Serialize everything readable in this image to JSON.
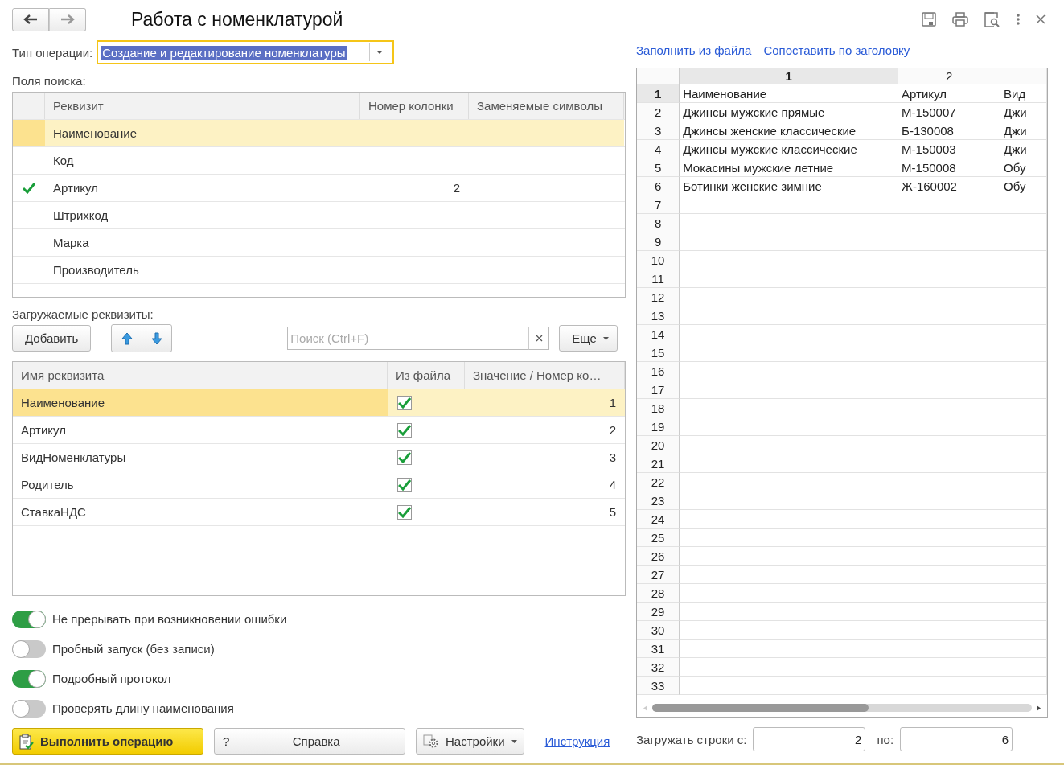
{
  "window": {
    "title": "Работа с номенклатурой"
  },
  "operation_type": {
    "label": "Тип операции:",
    "value": "Создание и редактирование номенклатуры"
  },
  "search_fields": {
    "label": "Поля поиска:",
    "columns": [
      "Реквизит",
      "Номер колонки",
      "Заменяемые символы"
    ],
    "rows": [
      {
        "name": "Наименование",
        "checked": false,
        "selected": true
      },
      {
        "name": "Код",
        "checked": false,
        "selected": false
      },
      {
        "name": "Артикул",
        "checked": true,
        "column": "2",
        "selected": false
      },
      {
        "name": "Штрихкод",
        "checked": false,
        "selected": false
      },
      {
        "name": "Марка",
        "checked": false,
        "selected": false
      },
      {
        "name": "Производитель",
        "checked": false,
        "selected": false
      }
    ]
  },
  "loaded_attributes": {
    "label": "Загружаемые реквизиты:",
    "add_button": "Добавить",
    "search": {
      "placeholder": "Поиск (Ctrl+F)"
    },
    "more_button": "Еще",
    "columns": [
      "Имя реквизита",
      "Из файла",
      "Значение / Номер ко…"
    ],
    "rows": [
      {
        "name": "Наименование",
        "from_file": true,
        "value": "1",
        "selected": true
      },
      {
        "name": "Артикул",
        "from_file": true,
        "value": "2",
        "selected": false
      },
      {
        "name": "ВидНоменклатуры",
        "from_file": true,
        "value": "3",
        "selected": false
      },
      {
        "name": "Родитель",
        "from_file": true,
        "value": "4",
        "selected": false
      },
      {
        "name": "СтавкаНДС",
        "from_file": true,
        "value": "5",
        "selected": false
      }
    ]
  },
  "options": [
    {
      "label": "Не прерывать при возникновении ошибки",
      "on": true
    },
    {
      "label": "Пробный запуск (без записи)",
      "on": false
    },
    {
      "label": "Подробный протокол",
      "on": true
    },
    {
      "label": "Проверять длину наименования",
      "on": false
    }
  ],
  "actions": {
    "run": "Выполнить операцию",
    "help_mark": "?",
    "help": "Справка",
    "settings": "Настройки",
    "link": "Инструкция"
  },
  "file_links": [
    "Заполнить из файла",
    "Сопоставить по заголовку"
  ],
  "sheet": {
    "columns": [
      {
        "label": "1",
        "selected": true
      },
      {
        "label": "2",
        "selected": false
      },
      {
        "selected": false
      }
    ],
    "rows": [
      {
        "number": "1",
        "selected": true,
        "cells": [
          "Наименование",
          "Артикул",
          "Вид"
        ]
      },
      {
        "number": "2",
        "selected": false,
        "cells": [
          "Джинсы мужские прямые",
          "М-150007",
          "Джи"
        ]
      },
      {
        "number": "3",
        "selected": false,
        "cells": [
          "Джинсы женские классические",
          "Б-130008",
          "Джи"
        ]
      },
      {
        "number": "4",
        "selected": false,
        "cells": [
          "Джинсы мужские классические",
          "М-150003",
          "Джи"
        ]
      },
      {
        "number": "5",
        "selected": false,
        "cells": [
          "Мокасины мужские летние",
          "М-150008",
          "Обу"
        ]
      },
      {
        "number": "6",
        "selected": false,
        "cells": [
          "Ботинки женские зимние",
          "Ж-160002",
          "Обу"
        ]
      },
      {
        "number": "7",
        "selected": false
      },
      {
        "number": "8",
        "selected": false
      },
      {
        "number": "9",
        "selected": false
      },
      {
        "number": "10",
        "selected": false
      },
      {
        "number": "11",
        "selected": false
      },
      {
        "number": "12",
        "selected": false
      },
      {
        "number": "13",
        "selected": false
      },
      {
        "number": "14",
        "selected": false
      },
      {
        "number": "15",
        "selected": false
      },
      {
        "number": "16",
        "selected": false
      },
      {
        "number": "17",
        "selected": false
      },
      {
        "number": "18",
        "selected": false
      },
      {
        "number": "19",
        "selected": false
      },
      {
        "number": "20",
        "selected": false
      },
      {
        "number": "21",
        "selected": false
      },
      {
        "number": "22",
        "selected": false
      },
      {
        "number": "23",
        "selected": false
      },
      {
        "number": "24",
        "selected": false
      },
      {
        "number": "25",
        "selected": false
      },
      {
        "number": "26",
        "selected": false
      },
      {
        "number": "27",
        "selected": false
      },
      {
        "number": "28",
        "selected": false
      },
      {
        "number": "29",
        "selected": false
      },
      {
        "number": "30",
        "selected": false
      },
      {
        "number": "31",
        "selected": false
      },
      {
        "number": "32",
        "selected": false
      },
      {
        "number": "33",
        "selected": false
      }
    ]
  },
  "load_rows": {
    "from_label": "Загружать строки с:",
    "from": "2",
    "to_label": "по:",
    "to": "6"
  }
}
